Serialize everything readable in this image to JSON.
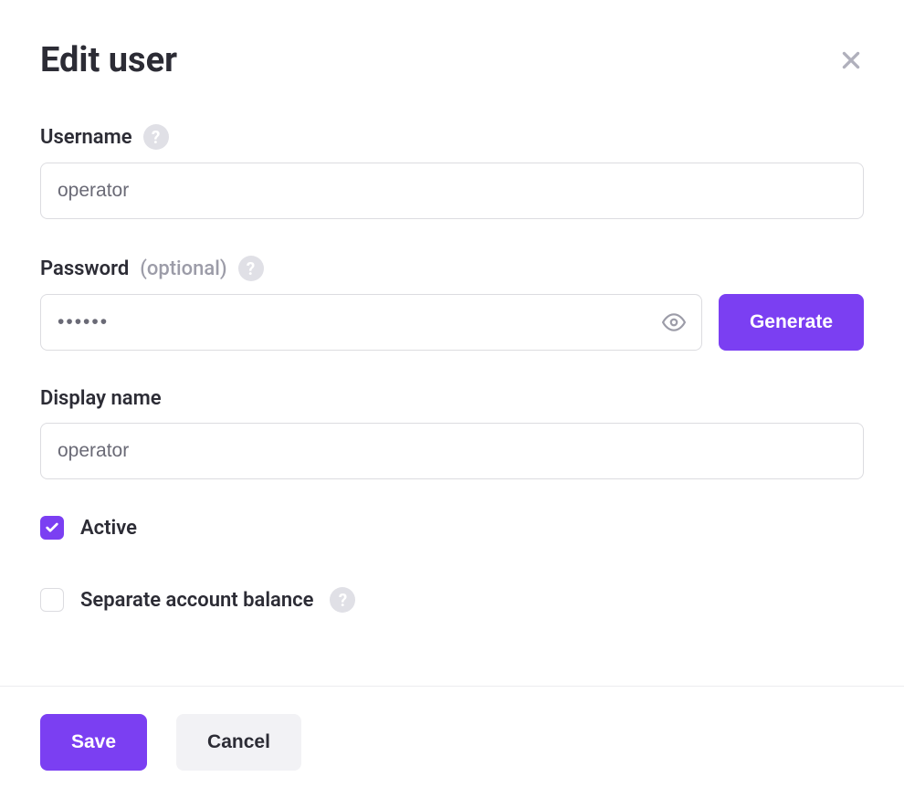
{
  "dialog": {
    "title": "Edit user"
  },
  "fields": {
    "username": {
      "label": "Username",
      "value": "operator"
    },
    "password": {
      "label": "Password",
      "hint": "(optional)",
      "value": "••••••",
      "generate_label": "Generate"
    },
    "display_name": {
      "label": "Display name",
      "value": "operator"
    },
    "active": {
      "label": "Active",
      "checked": true
    },
    "separate_balance": {
      "label": "Separate account balance",
      "checked": false
    }
  },
  "actions": {
    "save": "Save",
    "cancel": "Cancel"
  }
}
